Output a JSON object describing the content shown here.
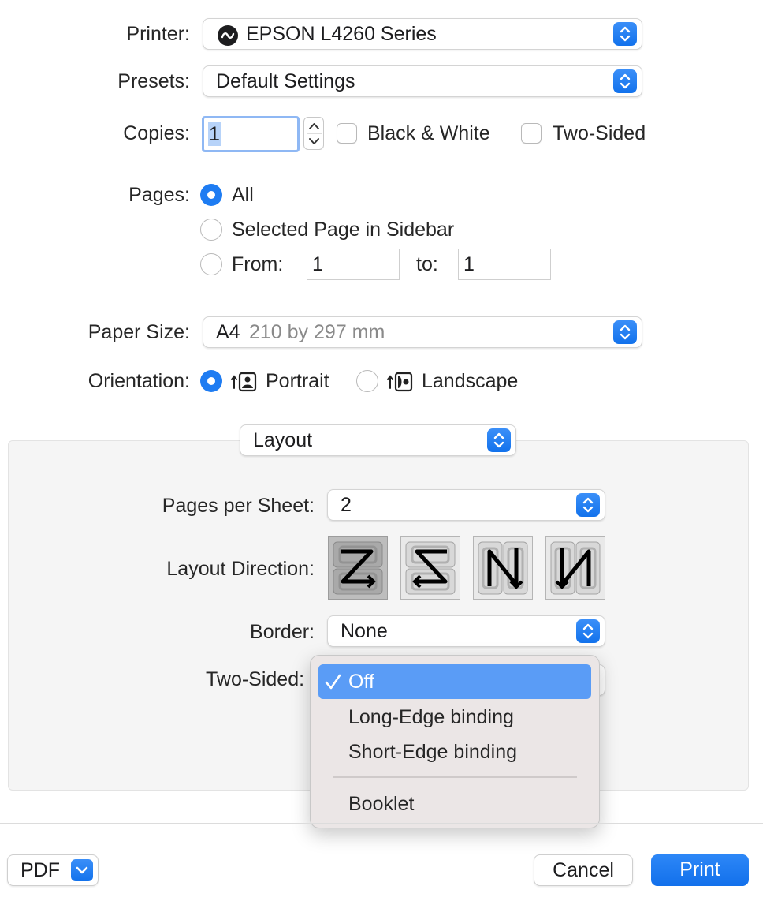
{
  "printer": {
    "label": "Printer:",
    "value": "EPSON L4260 Series",
    "icon": "printer-status-icon"
  },
  "presets": {
    "label": "Presets:",
    "value": "Default Settings"
  },
  "copies": {
    "label": "Copies:",
    "value": "1",
    "black_white": "Black & White",
    "two_sided": "Two-Sided"
  },
  "pages": {
    "label": "Pages:",
    "all": "All",
    "selected": "Selected Page in Sidebar",
    "from_label": "From:",
    "from_value": "1",
    "to_label": "to:",
    "to_value": "1",
    "selected_option": "All"
  },
  "paper": {
    "label": "Paper Size:",
    "value": "A4",
    "detail": "210 by 297 mm"
  },
  "orientation": {
    "label": "Orientation:",
    "portrait": "Portrait",
    "landscape": "Landscape",
    "selected": "Portrait"
  },
  "section": {
    "value": "Layout"
  },
  "layout": {
    "pages_per_sheet_label": "Pages per Sheet:",
    "pages_per_sheet": "2",
    "direction_label": "Layout Direction:",
    "directions": [
      "z-direction-icon",
      "reverse-z-direction-icon",
      "reverse-n-direction-icon",
      "n-direction-icon"
    ],
    "border_label": "Border:",
    "border": "None",
    "two_sided_label": "Two-Sided:"
  },
  "two_sided_menu": {
    "items": [
      "Off",
      "Long-Edge binding",
      "Short-Edge binding",
      "Booklet"
    ],
    "selected": "Off"
  },
  "footer": {
    "pdf": "PDF",
    "cancel": "Cancel",
    "print": "Print"
  },
  "colors": {
    "accent": "#1e7cf2",
    "menu_highlight": "#5a9cf6"
  }
}
